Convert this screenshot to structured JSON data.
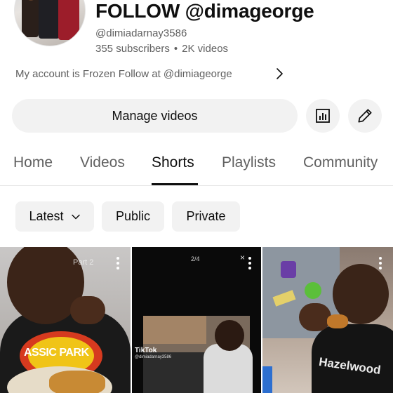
{
  "channel": {
    "name": "FOLLOW @dimageorge",
    "handle": "@dimiadarnay3586",
    "subscribers": "355 subscribers",
    "separator": "•",
    "videos": "2K videos",
    "description": "My account is Frozen Follow at @dimiageorge"
  },
  "actions": {
    "manage_label": "Manage videos",
    "analytics_icon": "analytics-icon",
    "edit_icon": "pencil-icon"
  },
  "tabs": [
    {
      "label": "Home"
    },
    {
      "label": "Videos"
    },
    {
      "label": "Shorts",
      "active": true
    },
    {
      "label": "Playlists"
    },
    {
      "label": "Community"
    }
  ],
  "filters": {
    "latest": "Latest",
    "public": "Public",
    "private": "Private"
  },
  "shorts": [
    {
      "overlay_text": "Part 2",
      "shirt_text": "ASSIC PARK"
    },
    {
      "page_indicator": "2/4",
      "watermark": "TikTok",
      "watermark_user": "@dimiadarnay3586"
    },
    {
      "shirt_text": "Hazelwood"
    }
  ],
  "colors": {
    "text_primary": "#0f0f0f",
    "text_secondary": "#606060",
    "chip_bg": "#f2f2f2",
    "active_tab": "#0f0f0f"
  }
}
